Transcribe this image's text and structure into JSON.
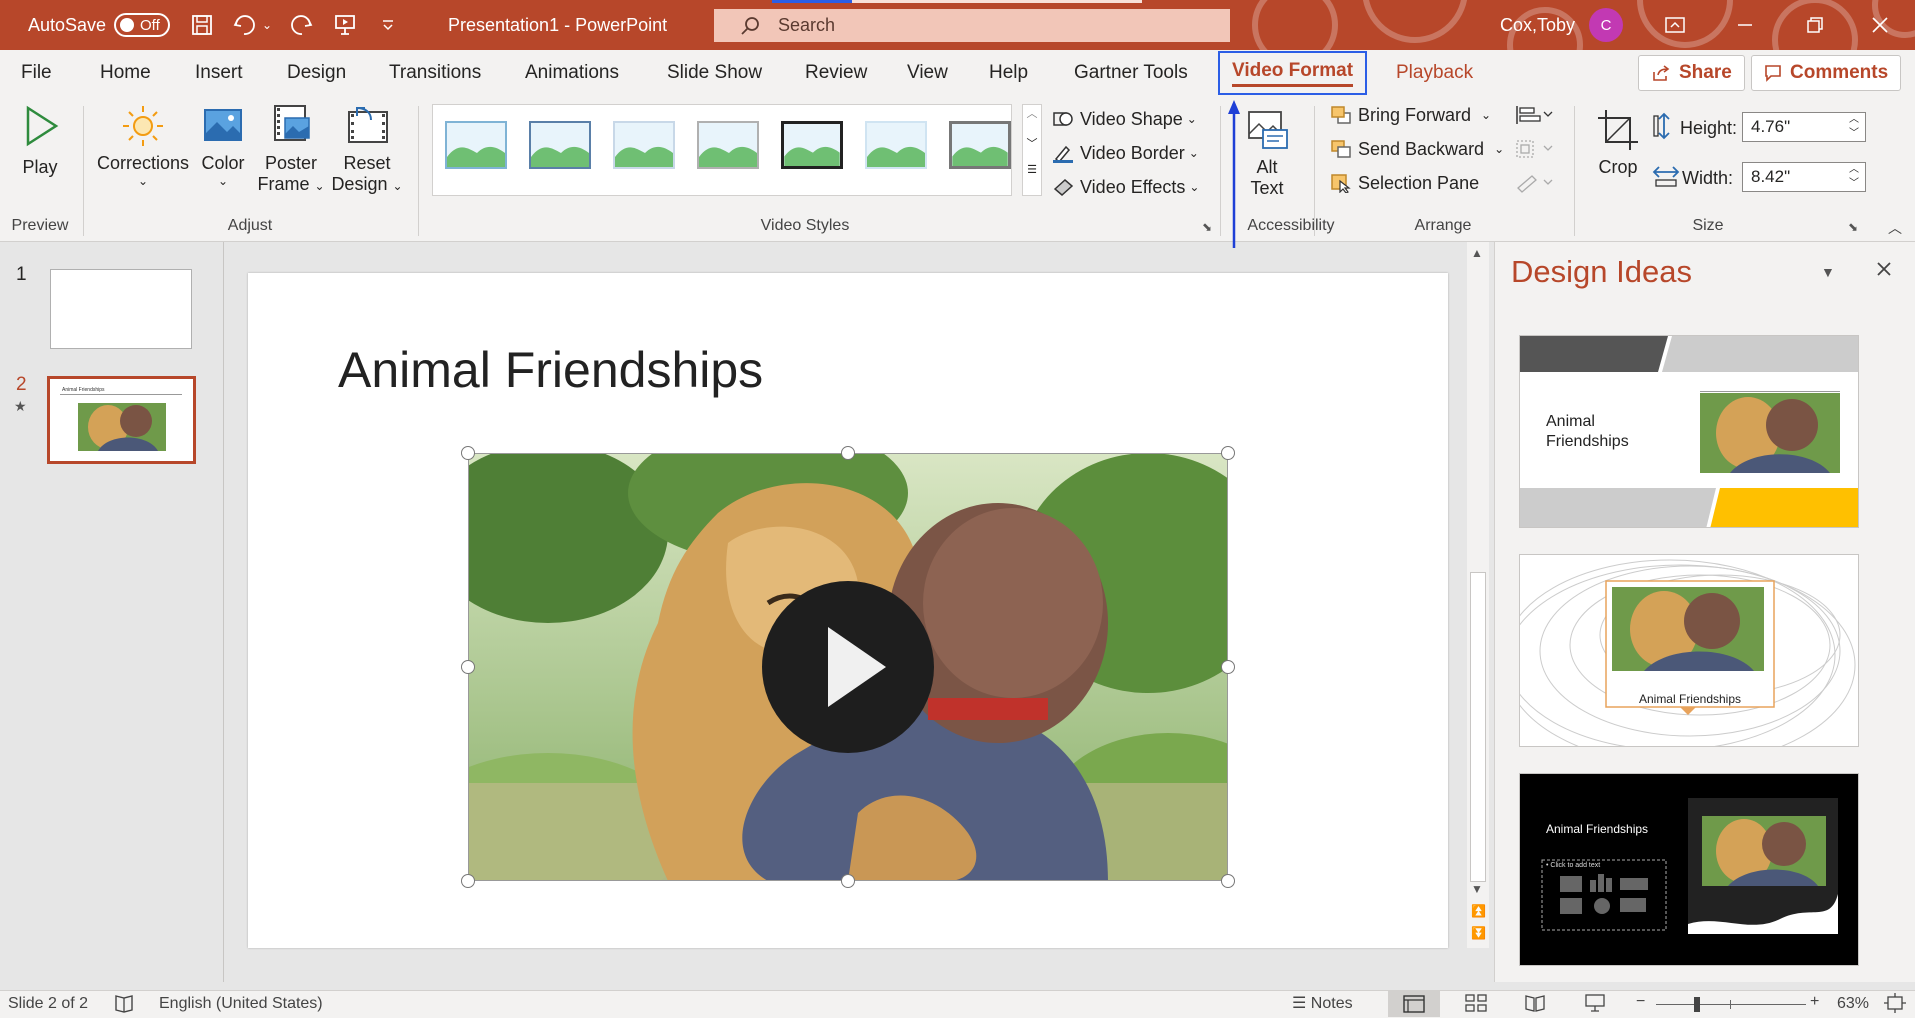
{
  "titlebar": {
    "autosave_label": "AutoSave",
    "autosave_state": "Off",
    "document_title": "Presentation1  -  PowerPoint",
    "search_placeholder": "Search",
    "user_name": "Cox,Toby",
    "user_initial": "C"
  },
  "tabs": {
    "file": "File",
    "home": "Home",
    "insert": "Insert",
    "design": "Design",
    "transitions": "Transitions",
    "animations": "Animations",
    "slideshow": "Slide Show",
    "review": "Review",
    "view": "View",
    "help": "Help",
    "gartner": "Gartner Tools",
    "video_format": "Video Format",
    "playback": "Playback",
    "share": "Share",
    "comments": "Comments"
  },
  "ribbon": {
    "play": "Play",
    "corrections": "Corrections",
    "color": "Color",
    "poster_frame_1": "Poster",
    "poster_frame_2": "Frame",
    "reset_design_1": "Reset",
    "reset_design_2": "Design",
    "video_shape": "Video Shape",
    "video_border": "Video Border",
    "video_effects": "Video Effects",
    "alt_text_1": "Alt",
    "alt_text_2": "Text",
    "bring_forward": "Bring Forward",
    "send_backward": "Send Backward",
    "selection_pane": "Selection Pane",
    "crop": "Crop",
    "height_label": "Height:",
    "height_value": "4.76\"",
    "width_label": "Width:",
    "width_value": "8.42\"",
    "groups": {
      "preview": "Preview",
      "adjust": "Adjust",
      "video_styles": "Video Styles",
      "accessibility": "Accessibility",
      "arrange": "Arrange",
      "size": "Size"
    }
  },
  "slides_panel": {
    "slide1_num": "1",
    "slide2_num": "2",
    "slide2_mark": "★",
    "slide2_mini_title": "Animal Friendships"
  },
  "slide": {
    "title": "Animal Friendships"
  },
  "design_ideas": {
    "title": "Design Ideas",
    "idea1_text": "Animal Friendships",
    "idea2_text": "Animal Friendships",
    "idea3_text": "Animal Friendships",
    "idea3_placeholder": "• Click to add text"
  },
  "statusbar": {
    "slide_info": "Slide 2 of 2",
    "language": "English (United States)",
    "notes": "Notes",
    "zoom": "63%"
  },
  "colors": {
    "accent": "#b7472a",
    "highlight": "#2b5ee6",
    "avatar": "#c239b3"
  }
}
